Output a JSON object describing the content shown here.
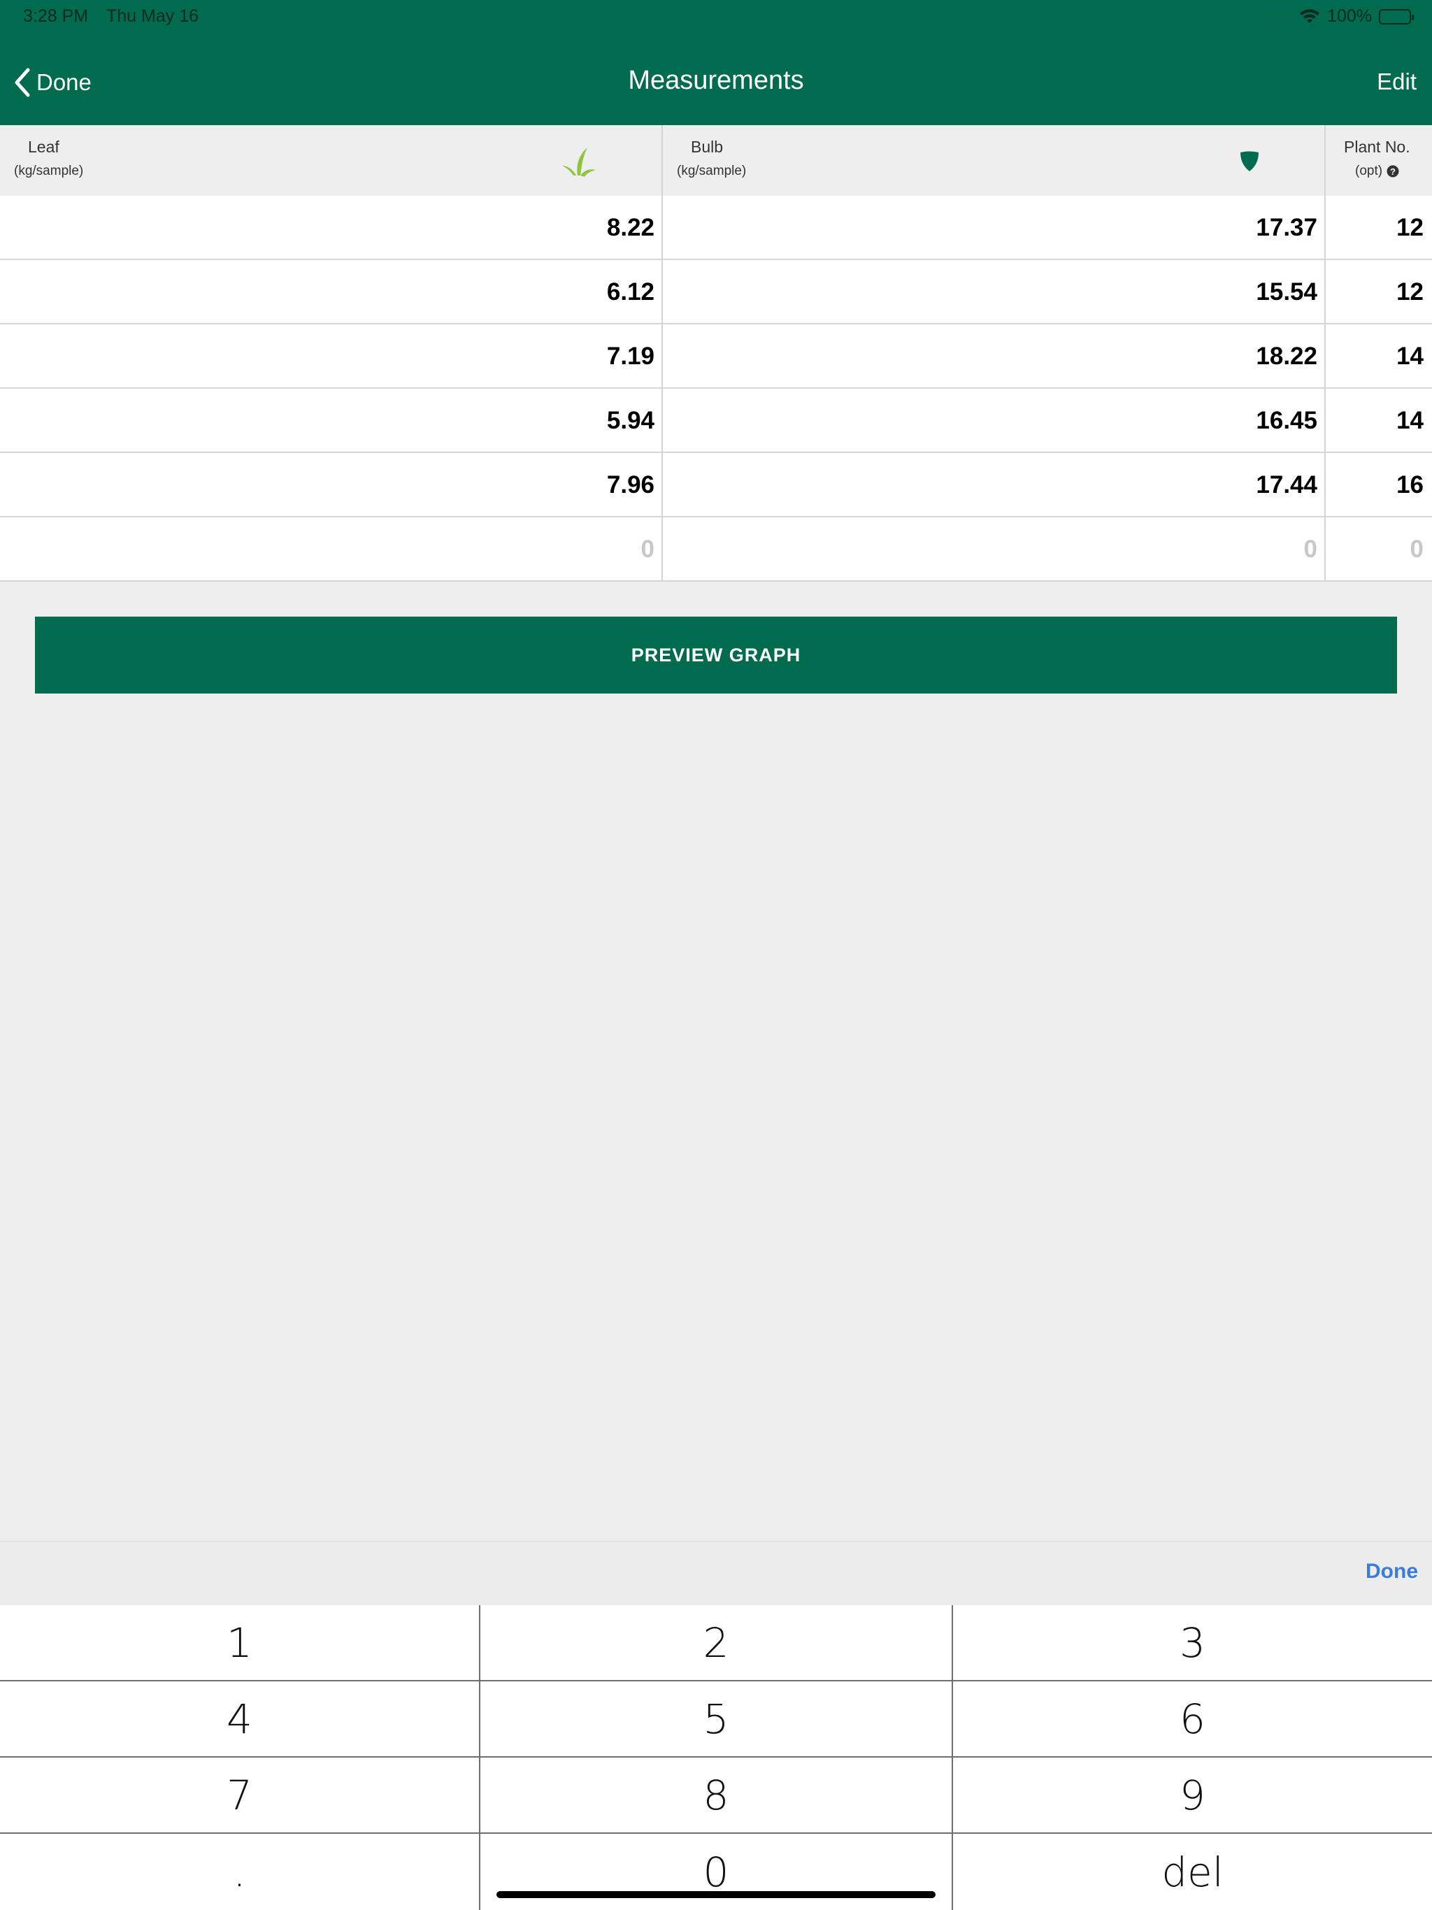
{
  "status_bar": {
    "time": "3:28 PM",
    "date": "Thu May 16",
    "battery": "100%"
  },
  "nav": {
    "back_label": "Done",
    "title": "Measurements",
    "edit_label": "Edit"
  },
  "table": {
    "columns": [
      {
        "label": "Leaf",
        "unit": "(kg/sample)",
        "icon": "leaf-icon"
      },
      {
        "label": "Bulb",
        "unit": "(kg/sample)",
        "icon": "bulb-icon"
      },
      {
        "label": "Plant No.",
        "unit": "(opt)",
        "icon": "help-icon"
      }
    ],
    "rows": [
      [
        "8.22",
        "17.37",
        "12"
      ],
      [
        "6.12",
        "15.54",
        "12"
      ],
      [
        "7.19",
        "18.22",
        "14"
      ],
      [
        "5.94",
        "16.45",
        "14"
      ],
      [
        "7.96",
        "17.44",
        "16"
      ],
      [
        "0",
        "0",
        "0"
      ]
    ]
  },
  "preview_button": "PREVIEW GRAPH",
  "keyboard": {
    "done_label": "Done",
    "keys": [
      "1",
      "2",
      "3",
      "4",
      "5",
      "6",
      "7",
      "8",
      "9",
      ".",
      "0",
      "del"
    ]
  },
  "colors": {
    "brand": "#006b4f",
    "leaf_icon": "#8dc63f",
    "link": "#3a7ce0"
  }
}
